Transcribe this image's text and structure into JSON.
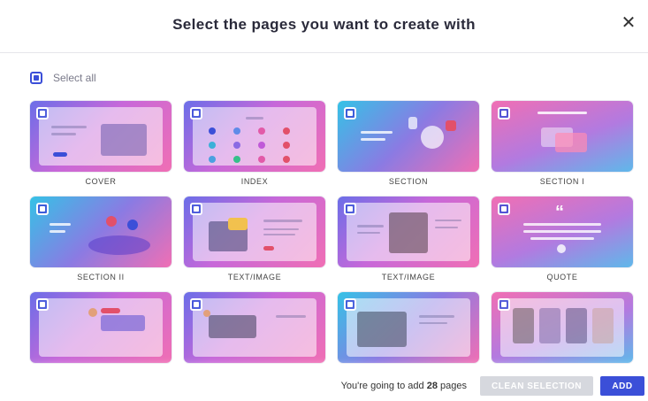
{
  "header": {
    "title": "Select the pages you want to create with",
    "close_glyph": "✕"
  },
  "select_all": {
    "label": "Select all",
    "checked": true
  },
  "pages": [
    {
      "caption": "COVER",
      "checked": true,
      "thumb_text": "Marketing Series",
      "style": "g1"
    },
    {
      "caption": "INDEX",
      "checked": true,
      "thumb_text": "Index",
      "style": "g1"
    },
    {
      "caption": "SECTION",
      "checked": true,
      "thumb_text": "Write your title here",
      "style": "g2"
    },
    {
      "caption": "SECTION I",
      "checked": true,
      "thumb_text": "Write your title here",
      "style": "g3"
    },
    {
      "caption": "SECTION II",
      "checked": true,
      "thumb_text": "Write your title here",
      "style": "g2"
    },
    {
      "caption": "TEXT/IMAGE",
      "checked": true,
      "thumb_text": "Write your title here",
      "style": "g1"
    },
    {
      "caption": "TEXT/IMAGE",
      "checked": true,
      "thumb_text": "Write your title",
      "style": "g1"
    },
    {
      "caption": "QUOTE",
      "checked": true,
      "thumb_text": "“",
      "style": "g3"
    },
    {
      "caption": "",
      "checked": true,
      "thumb_text": "",
      "style": "g1"
    },
    {
      "caption": "",
      "checked": true,
      "thumb_text": "",
      "style": "g1"
    },
    {
      "caption": "",
      "checked": true,
      "thumb_text": "",
      "style": "g2"
    },
    {
      "caption": "",
      "checked": true,
      "thumb_text": "",
      "style": "g3"
    }
  ],
  "footer": {
    "count_prefix": "You're going to add ",
    "count_value": "28",
    "count_suffix": " pages",
    "clean_label": "CLEAN SELECTION",
    "add_label": "ADD"
  },
  "colors": {
    "accent": "#3b4fd8",
    "disabled": "#d6d8de"
  }
}
